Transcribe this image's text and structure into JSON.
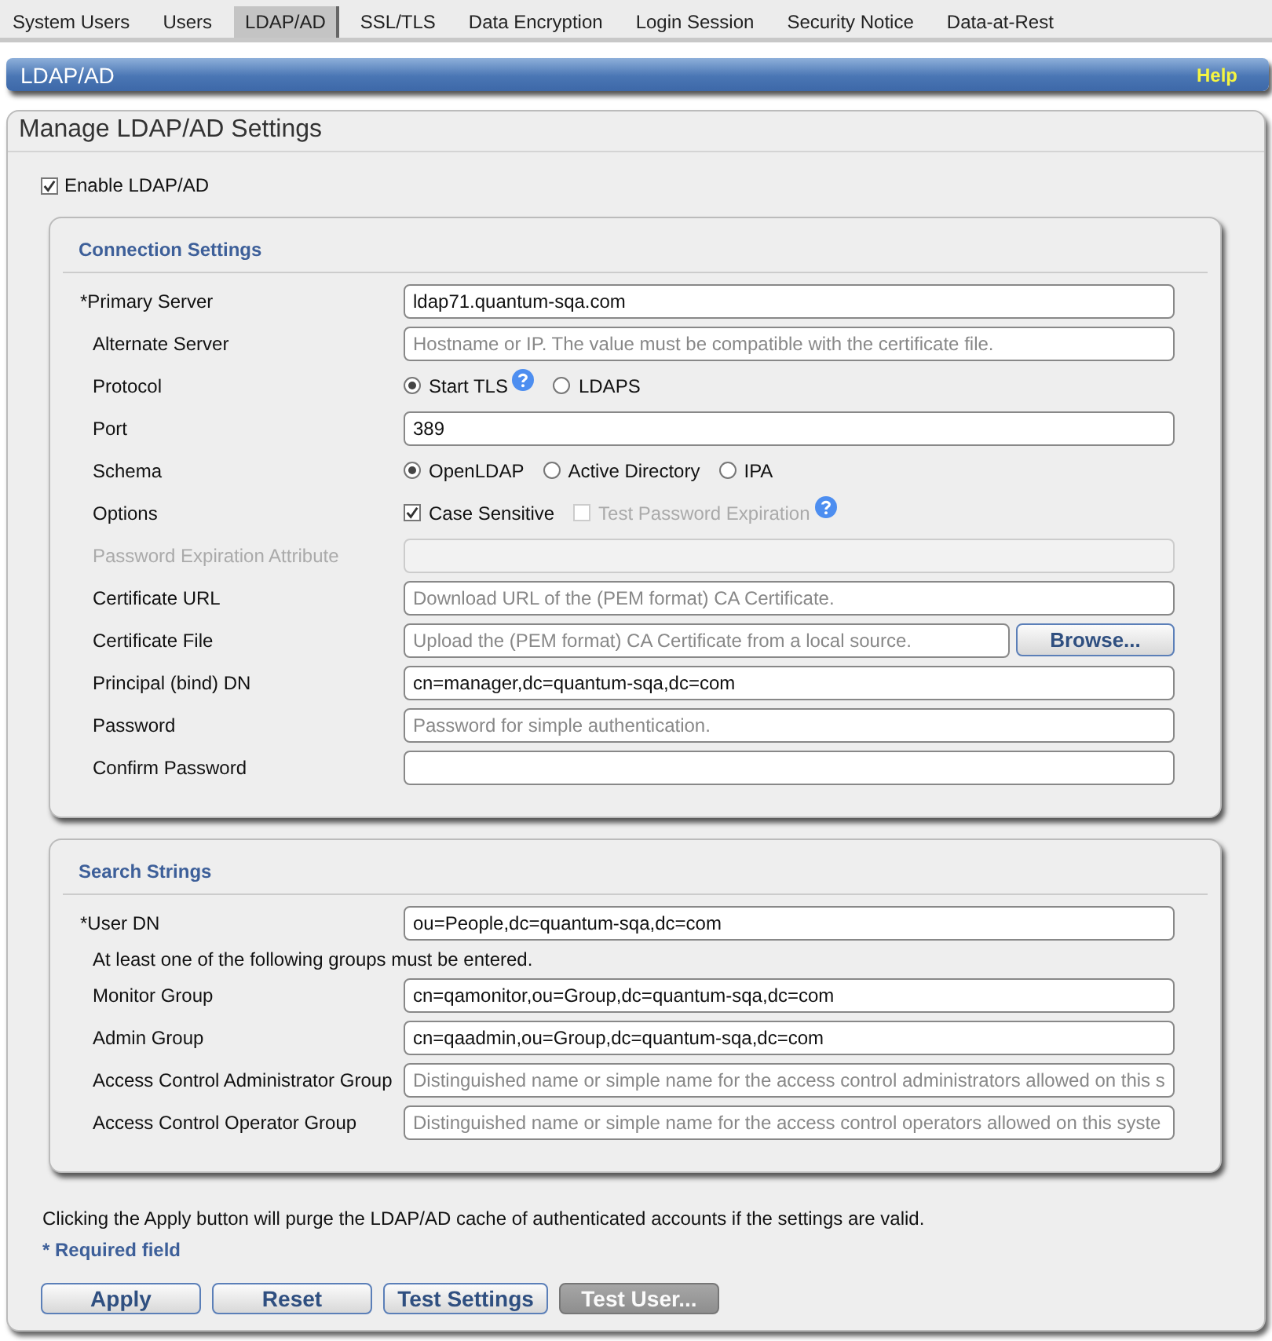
{
  "tabs": [
    {
      "label": "System Users",
      "selected": false
    },
    {
      "label": "Users",
      "selected": false
    },
    {
      "label": "LDAP/AD",
      "selected": true
    },
    {
      "label": "SSL/TLS",
      "selected": false
    },
    {
      "label": "Data Encryption",
      "selected": false
    },
    {
      "label": "Login Session",
      "selected": false
    },
    {
      "label": "Security Notice",
      "selected": false
    },
    {
      "label": "Data-at-Rest",
      "selected": false
    }
  ],
  "header": {
    "title": "LDAP/AD",
    "help": "Help"
  },
  "panel": {
    "title": "Manage LDAP/AD Settings",
    "enable": {
      "label": "Enable LDAP/AD",
      "checked": true
    },
    "sections": [
      {
        "title": "Connection Settings",
        "rows": [
          {
            "kind": "input",
            "marker": "*",
            "label": "Primary Server",
            "value": "ldap71.quantum-sqa.com"
          },
          {
            "kind": "input",
            "label": "Alternate Server",
            "placeholder": "Hostname or IP. The value must be compatible with the certificate file."
          },
          {
            "kind": "radio",
            "label": "Protocol",
            "options": [
              {
                "label": "Start TLS",
                "selected": true,
                "help": true
              },
              {
                "label": "LDAPS",
                "selected": false
              }
            ]
          },
          {
            "kind": "input",
            "label": "Port",
            "value": "389"
          },
          {
            "kind": "radio",
            "label": "Schema",
            "options": [
              {
                "label": "OpenLDAP",
                "selected": true
              },
              {
                "label": "Active Directory",
                "selected": false
              },
              {
                "label": "IPA",
                "selected": false
              }
            ]
          },
          {
            "kind": "checks",
            "label": "Options",
            "options": [
              {
                "label": "Case Sensitive",
                "checked": true,
                "disabled": false
              },
              {
                "label": "Test Password Expiration",
                "checked": false,
                "disabled": true,
                "help": true
              }
            ]
          },
          {
            "kind": "input",
            "label": "Password Expiration Attribute",
            "disabled": true
          },
          {
            "kind": "input",
            "label": "Certificate URL",
            "placeholder": "Download URL of the (PEM format) CA Certificate."
          },
          {
            "kind": "file",
            "label": "Certificate File",
            "placeholder": "Upload the (PEM format) CA Certificate from a local source.",
            "button": "Browse..."
          },
          {
            "kind": "input",
            "label": "Principal (bind) DN",
            "value": "cn=manager,dc=quantum-sqa,dc=com"
          },
          {
            "kind": "input",
            "label": "Password",
            "placeholder": "Password for simple authentication."
          },
          {
            "kind": "input",
            "label": "Confirm Password"
          }
        ]
      },
      {
        "title": "Search Strings",
        "rows": [
          {
            "kind": "input",
            "marker": "*",
            "label": "User DN",
            "value": "ou=People,dc=quantum-sqa,dc=com"
          },
          {
            "kind": "note",
            "label": "At least one of the following groups must be entered."
          },
          {
            "kind": "input",
            "label": "Monitor Group",
            "value": "cn=qamonitor,ou=Group,dc=quantum-sqa,dc=com"
          },
          {
            "kind": "input",
            "label": "Admin Group",
            "value": "cn=qaadmin,ou=Group,dc=quantum-sqa,dc=com"
          },
          {
            "kind": "input",
            "label": "Access Control Administrator Group",
            "placeholder": "Distinguished name or simple name for the access control administrators allowed on this s"
          },
          {
            "kind": "input",
            "label": "Access Control Operator Group",
            "placeholder": "Distinguished name or simple name for the access control operators allowed on this syste"
          }
        ]
      }
    ],
    "info": "Clicking the Apply button will purge the LDAP/AD cache of authenticated accounts if the settings are valid.",
    "required_note": "* Required field",
    "buttons": [
      {
        "label": "Apply",
        "disabled": false
      },
      {
        "label": "Reset",
        "disabled": false
      },
      {
        "label": "Test Settings",
        "disabled": false
      },
      {
        "label": "Test User...",
        "disabled": true
      }
    ]
  }
}
